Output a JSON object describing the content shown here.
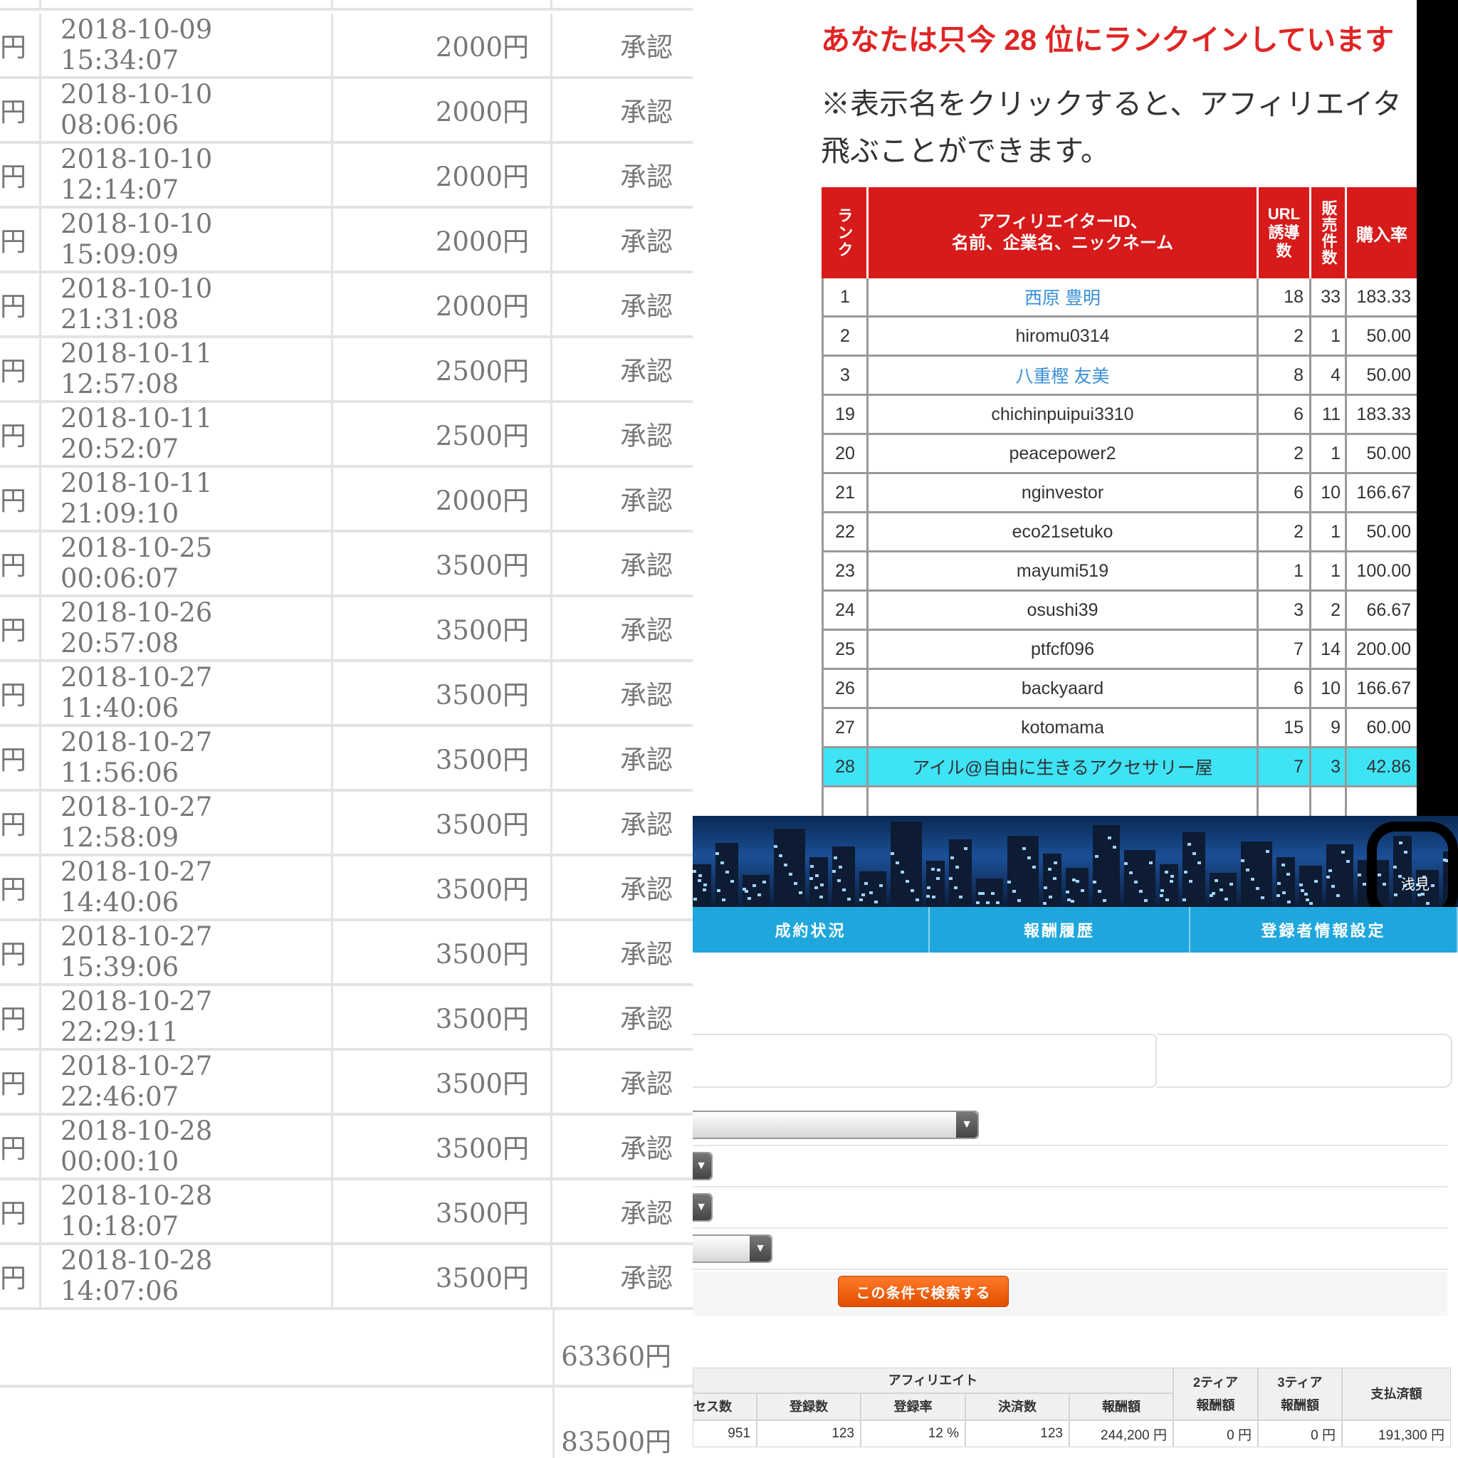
{
  "payments": {
    "currency_fragment": "円",
    "rows": [
      {
        "datetime": "2018-10-09 15:34:07",
        "amount": "2000円",
        "status": "承認"
      },
      {
        "datetime": "2018-10-10 08:06:06",
        "amount": "2000円",
        "status": "承認"
      },
      {
        "datetime": "2018-10-10 12:14:07",
        "amount": "2000円",
        "status": "承認"
      },
      {
        "datetime": "2018-10-10 15:09:09",
        "amount": "2000円",
        "status": "承認"
      },
      {
        "datetime": "2018-10-10 21:31:08",
        "amount": "2000円",
        "status": "承認"
      },
      {
        "datetime": "2018-10-11 12:57:08",
        "amount": "2500円",
        "status": "承認"
      },
      {
        "datetime": "2018-10-11 20:52:07",
        "amount": "2500円",
        "status": "承認"
      },
      {
        "datetime": "2018-10-11 21:09:10",
        "amount": "2000円",
        "status": "承認"
      },
      {
        "datetime": "2018-10-25 00:06:07",
        "amount": "3500円",
        "status": "承認"
      },
      {
        "datetime": "2018-10-26 20:57:08",
        "amount": "3500円",
        "status": "承認"
      },
      {
        "datetime": "2018-10-27 11:40:06",
        "amount": "3500円",
        "status": "承認"
      },
      {
        "datetime": "2018-10-27 11:56:06",
        "amount": "3500円",
        "status": "承認"
      },
      {
        "datetime": "2018-10-27 12:58:09",
        "amount": "3500円",
        "status": "承認"
      },
      {
        "datetime": "2018-10-27 14:40:06",
        "amount": "3500円",
        "status": "承認"
      },
      {
        "datetime": "2018-10-27 15:39:06",
        "amount": "3500円",
        "status": "承認"
      },
      {
        "datetime": "2018-10-27 22:29:11",
        "amount": "3500円",
        "status": "承認"
      },
      {
        "datetime": "2018-10-27 22:46:07",
        "amount": "3500円",
        "status": "承認"
      },
      {
        "datetime": "2018-10-28 00:00:10",
        "amount": "3500円",
        "status": "承認"
      },
      {
        "datetime": "2018-10-28 10:18:07",
        "amount": "3500円",
        "status": "承認"
      },
      {
        "datetime": "2018-10-28 14:07:06",
        "amount": "3500円",
        "status": "承認"
      }
    ],
    "subtotal": "63360円",
    "total": "83500円"
  },
  "ranking": {
    "headline": "あなたは只今 28 位にランクインしています",
    "note_line1": "※表示名をクリックすると、アフィリエイタ",
    "note_line2": "飛ぶことができます。",
    "headers": {
      "rank": "ランク",
      "id_line1": "アフィリエイターID、",
      "id_line2": "名前、企業名、ニックネーム",
      "url": "URL 誘導 数",
      "sold": "販売件数",
      "rate": "購入率"
    },
    "rows": [
      {
        "rank": "1",
        "name": "西原 豊明",
        "url": "18",
        "sold": "33",
        "rate": "183.33",
        "link": true
      },
      {
        "rank": "2",
        "name": "hiromu0314",
        "url": "2",
        "sold": "1",
        "rate": "50.00"
      },
      {
        "rank": "3",
        "name": "八重樫 友美",
        "url": "8",
        "sold": "4",
        "rate": "50.00",
        "link": true
      },
      {
        "rank": "19",
        "name": "chichinpuipui3310",
        "url": "6",
        "sold": "11",
        "rate": "183.33"
      },
      {
        "rank": "20",
        "name": "peacepower2",
        "url": "2",
        "sold": "1",
        "rate": "50.00"
      },
      {
        "rank": "21",
        "name": "nginvestor",
        "url": "6",
        "sold": "10",
        "rate": "166.67"
      },
      {
        "rank": "22",
        "name": "eco21setuko",
        "url": "2",
        "sold": "1",
        "rate": "50.00"
      },
      {
        "rank": "23",
        "name": "mayumi519",
        "url": "1",
        "sold": "1",
        "rate": "100.00"
      },
      {
        "rank": "24",
        "name": "osushi39",
        "url": "3",
        "sold": "2",
        "rate": "66.67"
      },
      {
        "rank": "25",
        "name": "ptfcf096",
        "url": "7",
        "sold": "14",
        "rate": "200.00"
      },
      {
        "rank": "26",
        "name": "backyaard",
        "url": "6",
        "sold": "10",
        "rate": "166.67"
      },
      {
        "rank": "27",
        "name": "kotomama",
        "url": "15",
        "sold": "9",
        "rate": "60.00"
      },
      {
        "rank": "28",
        "name": "アイル@自由に生きるアクセサリー屋",
        "url": "7",
        "sold": "3",
        "rate": "42.86",
        "highlight": true
      }
    ]
  },
  "dashboard": {
    "user_name": "浅見",
    "tabs": [
      "成約状況",
      "報酬履歴",
      "登録者情報設定"
    ],
    "search_button": "この条件で検索する",
    "stats": {
      "group_affiliate": "アフィリエイト",
      "tier2": "2ティア",
      "tier3": "3ティア",
      "reward_label": "報酬額",
      "paid_label": "支払済額",
      "col_access": "セス数",
      "col_reg": "登録数",
      "col_reg_rate": "登録率",
      "col_settle": "決済数",
      "col_reward": "報酬額",
      "val_access": "951",
      "val_reg": "123",
      "val_reg_rate": "12 %",
      "val_settle": "123",
      "val_reward": "244,200 円",
      "val_tier2": "0 円",
      "val_tier3": "0 円",
      "val_paid": "191,300 円"
    }
  }
}
